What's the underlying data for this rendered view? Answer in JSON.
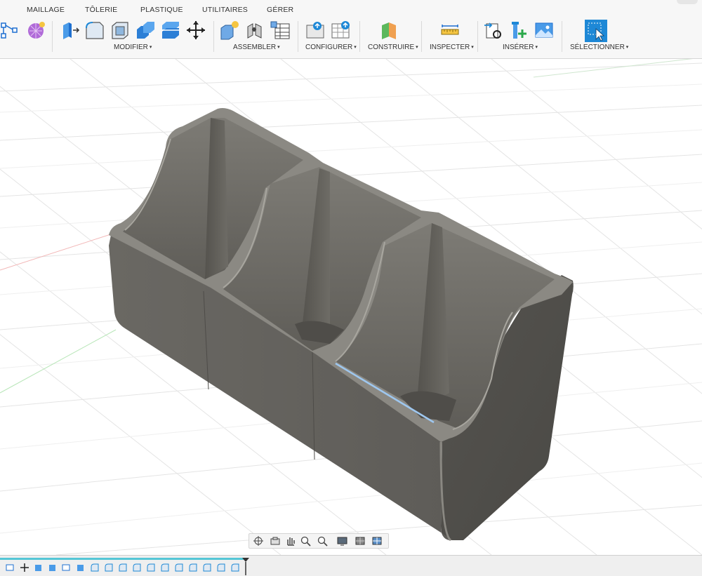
{
  "tabs": [
    "MAILLAGE",
    "TÔLERIE",
    "PLASTIQUE",
    "UTILITAIRES",
    "GÉRER"
  ],
  "groups": {
    "modifier": "MODIFIER",
    "assembler": "ASSEMBLER",
    "configurer": "CONFIGURER",
    "construire": "CONSTRUIRE",
    "inspecter": "INSPECTER",
    "inserer": "INSÉRER",
    "selectionner": "SÉLECTIONNER"
  },
  "dropdown_caret": "▾",
  "colors": {
    "toolbar_bg": "#f7f7f7",
    "accent_blue": "#1e88d6",
    "model_gray": "#6e6c67",
    "timeline_accent": "#54c6d6"
  }
}
